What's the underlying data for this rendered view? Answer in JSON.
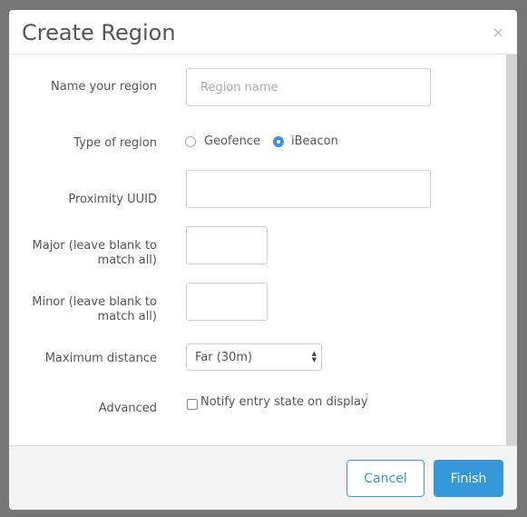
{
  "dialog": {
    "title": "Create Region",
    "close_icon": "×"
  },
  "form": {
    "name": {
      "label": "Name your region",
      "placeholder": "Region name",
      "value": ""
    },
    "type": {
      "label": "Type of region",
      "options": [
        "Geofence",
        "iBeacon"
      ],
      "selected": "iBeacon"
    },
    "uuid": {
      "label": "Proximity UUID",
      "value": ""
    },
    "major": {
      "label_line1": "Major (leave blank to",
      "label_line2": "match all)",
      "value": ""
    },
    "minor": {
      "label_line1": "Minor (leave blank to",
      "label_line2": "match all)",
      "value": ""
    },
    "distance": {
      "label": "Maximum distance",
      "selected": "Far (30m)"
    },
    "advanced": {
      "label": "Advanced",
      "checkbox_label": "Notify entry state on display",
      "help": "?",
      "checked": false
    }
  },
  "footer": {
    "cancel_label": "Cancel",
    "finish_label": "Finish"
  },
  "colors": {
    "accent": "#3498db",
    "overlay": "#777777"
  }
}
